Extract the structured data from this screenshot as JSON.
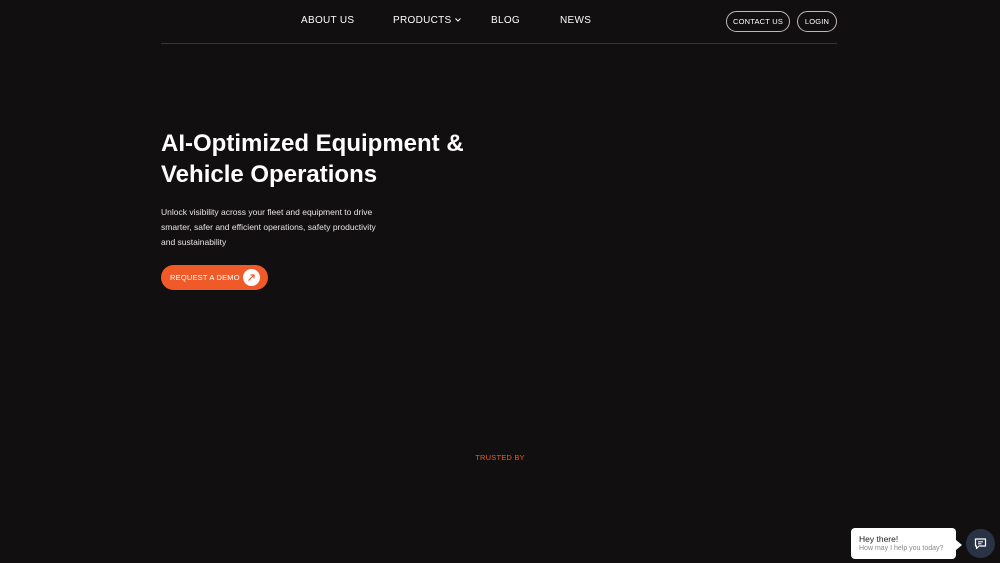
{
  "nav": {
    "about": "ABOUT US",
    "products": "PRODUCTS",
    "blog": "BLOG",
    "news": "NEWS",
    "contact": "CONTACT US",
    "login": "LOGIN"
  },
  "hero": {
    "title_line1": "AI-Optimized Equipment &",
    "title_line2": "Vehicle Operations",
    "desc_line1": "Unlock visibility across your fleet and equipment to drive",
    "desc_line2": "smarter, safer and efficient operations, safety productivity",
    "desc_line3": "and sustainability",
    "cta_label": "REQUEST A DEMO",
    "cta_icon": "arrow-up-right-icon"
  },
  "trusted": {
    "label": "TRUSTED BY"
  },
  "chat": {
    "title": "Hey there!",
    "subtitle": "How may I help you today?",
    "launcher_icon": "chat-icon"
  },
  "colors": {
    "background": "#120f10",
    "accent": "#f05a28",
    "launcher": "#2a3346"
  }
}
